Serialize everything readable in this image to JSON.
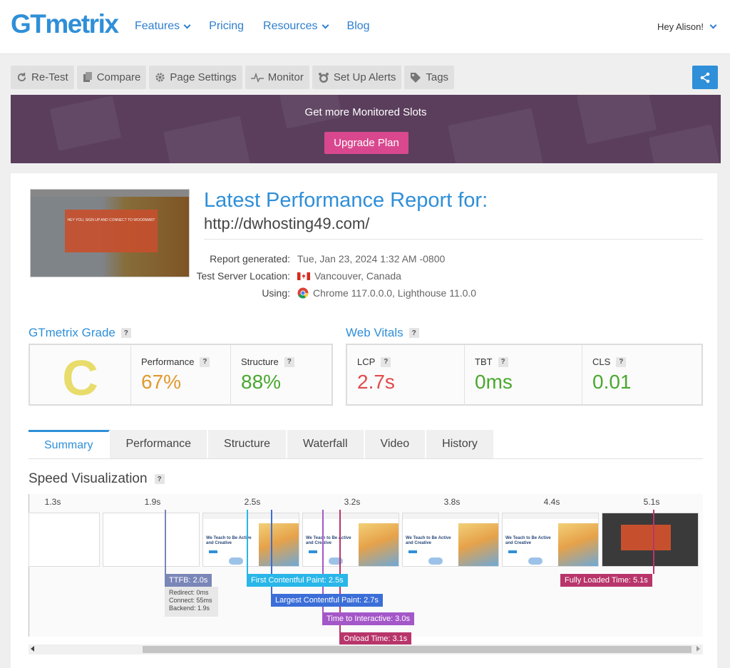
{
  "header": {
    "logo": "GTmetrix",
    "nav": [
      {
        "label": "Features",
        "dropdown": true
      },
      {
        "label": "Pricing",
        "dropdown": false
      },
      {
        "label": "Resources",
        "dropdown": true
      },
      {
        "label": "Blog",
        "dropdown": false
      }
    ],
    "user_greeting": "Hey Alison!"
  },
  "toolbar": {
    "buttons": [
      {
        "label": "Re-Test",
        "icon": "refresh-icon"
      },
      {
        "label": "Compare",
        "icon": "compare-icon"
      },
      {
        "label": "Page Settings",
        "icon": "gear-icon"
      },
      {
        "label": "Monitor",
        "icon": "pulse-icon"
      },
      {
        "label": "Set Up Alerts",
        "icon": "alarm-icon"
      },
      {
        "label": "Tags",
        "icon": "tag-icon"
      }
    ],
    "share_icon": "share-icon"
  },
  "banner": {
    "title": "Get more Monitored Slots",
    "button": "Upgrade Plan"
  },
  "report": {
    "title": "Latest Performance Report for:",
    "url": "http://dwhosting49.com/",
    "meta": [
      {
        "label": "Report generated:",
        "value": "Tue, Jan 23, 2024 1:32 AM -0800",
        "icon": ""
      },
      {
        "label": "Test Server Location:",
        "value": "Vancouver, Canada",
        "icon": "canada-flag-icon"
      },
      {
        "label": "Using:",
        "value": "Chrome 117.0.0.0, Lighthouse 11.0.0",
        "icon": "chrome-icon"
      }
    ],
    "thumbnail_text": "HEY YOU, SIGN UP AND CONNECT TO WOODMART"
  },
  "grade": {
    "heading": "GTmetrix Grade",
    "letter": "C",
    "performance_label": "Performance",
    "performance_value": "67%",
    "structure_label": "Structure",
    "structure_value": "88%"
  },
  "vitals": {
    "heading": "Web Vitals",
    "lcp_label": "LCP",
    "lcp_value": "2.7s",
    "tbt_label": "TBT",
    "tbt_value": "0ms",
    "cls_label": "CLS",
    "cls_value": "0.01"
  },
  "colors": {
    "accent": "#2f8fd8",
    "grade_c": "#e8dc6a",
    "orange": "#e09a2e",
    "green": "#4aa830",
    "red": "#e24a4a",
    "banner": "#5a3e5c",
    "upgrade": "#d9488f"
  },
  "tabs": [
    "Summary",
    "Performance",
    "Structure",
    "Waterfall",
    "Video",
    "History"
  ],
  "active_tab": "Summary",
  "speed": {
    "heading": "Speed Visualization",
    "times": [
      "1.3s",
      "1.9s",
      "2.5s",
      "3.2s",
      "3.8s",
      "4.4s",
      "5.1s"
    ],
    "frame_text": "We Teach to Be Active and Creative",
    "milestones": {
      "ttfb": "TTFB: 2.0s",
      "ttfb_redirect": "Redirect: 0ms",
      "ttfb_connect": "Connect: 55ms",
      "ttfb_backend": "Backend: 1.9s",
      "fcp": "First Contentful Paint: 2.5s",
      "lcp": "Largest Contentful Paint: 2.7s",
      "tti": "Time to Interactive: 3.0s",
      "onload": "Onload Time: 3.1s",
      "fully": "Fully Loaded Time: 5.1s"
    }
  }
}
